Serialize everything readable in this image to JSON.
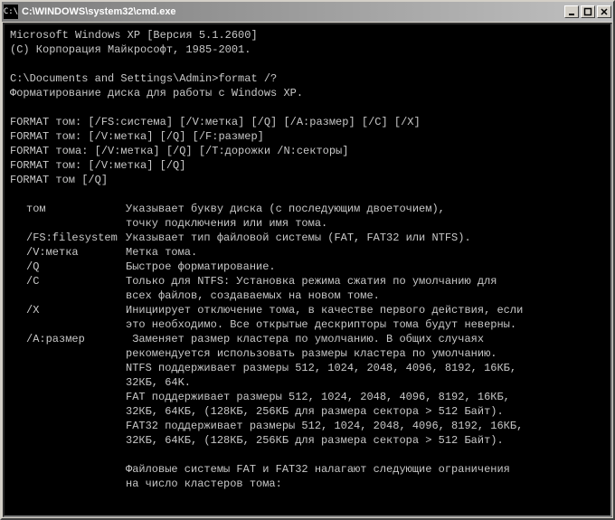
{
  "titlebar": {
    "icon_glyph": "C:\\",
    "title": "C:\\WINDOWS\\system32\\cmd.exe",
    "buttons": {
      "minimize": "_",
      "maximize": "□",
      "close": "✕"
    }
  },
  "console": {
    "header": [
      "Microsoft Windows XP [Версия 5.1.2600]",
      "(С) Корпорация Майкрософт, 1985-2001.",
      ""
    ],
    "prompt": "C:\\Documents and Settings\\Admin>",
    "command": "format /?",
    "description": "Форматирование диска для работы с Windows XP.",
    "syntax": [
      "FORMAT том: [/FS:система] [/V:метка] [/Q] [/A:размер] [/C] [/X]",
      "FORMAT том: [/V:метка] [/Q] [/F:размер]",
      "FORMAT тома: [/V:метка] [/Q] [/T:дорожки /N:секторы]",
      "FORMAT том: [/V:метка] [/Q]",
      "FORMAT том [/Q]"
    ],
    "options": [
      {
        "key": "том",
        "desc": "Указывает букву диска (с последующим двоеточием),\nточку подключения или имя тома."
      },
      {
        "key": "/FS:filesystem",
        "desc": "Указывает тип файловой системы (FAT, FAT32 или NTFS)."
      },
      {
        "key": "/V:метка",
        "desc": "Метка тома."
      },
      {
        "key": "/Q",
        "desc": "Быстрое форматирование."
      },
      {
        "key": "/C",
        "desc": "Только для NTFS: Установка режима сжатия по умолчанию для\nвсех файлов, создаваемых на новом томе."
      },
      {
        "key": "/X",
        "desc": "Инициирует отключение тома, в качестве первого действия, если\nэто необходимо. Все открытые дескрипторы тома будут неверны."
      },
      {
        "key": "/A:размер",
        "desc": " Заменяет размер кластера по умолчанию. В общих случаях\nрекомендуется использовать размеры кластера по умолчанию.\nNTFS поддерживает размеры 512, 1024, 2048, 4096, 8192, 16КБ,\n32КБ, 64K.\nFAT поддерживает размеры 512, 1024, 2048, 4096, 8192, 16КБ,\n32КБ, 64КБ, (128КБ, 256КБ для размера сектора > 512 Байт).\nFAT32 поддерживает размеры 512, 1024, 2048, 4096, 8192, 16КБ,\n32КБ, 64КБ, (128КБ, 256КБ для размера сектора > 512 Байт)."
      }
    ],
    "footer": [
      "",
      "Файловые системы FAT и FAT32 налагают следующие ограничения",
      "на число кластеров тома:"
    ]
  }
}
